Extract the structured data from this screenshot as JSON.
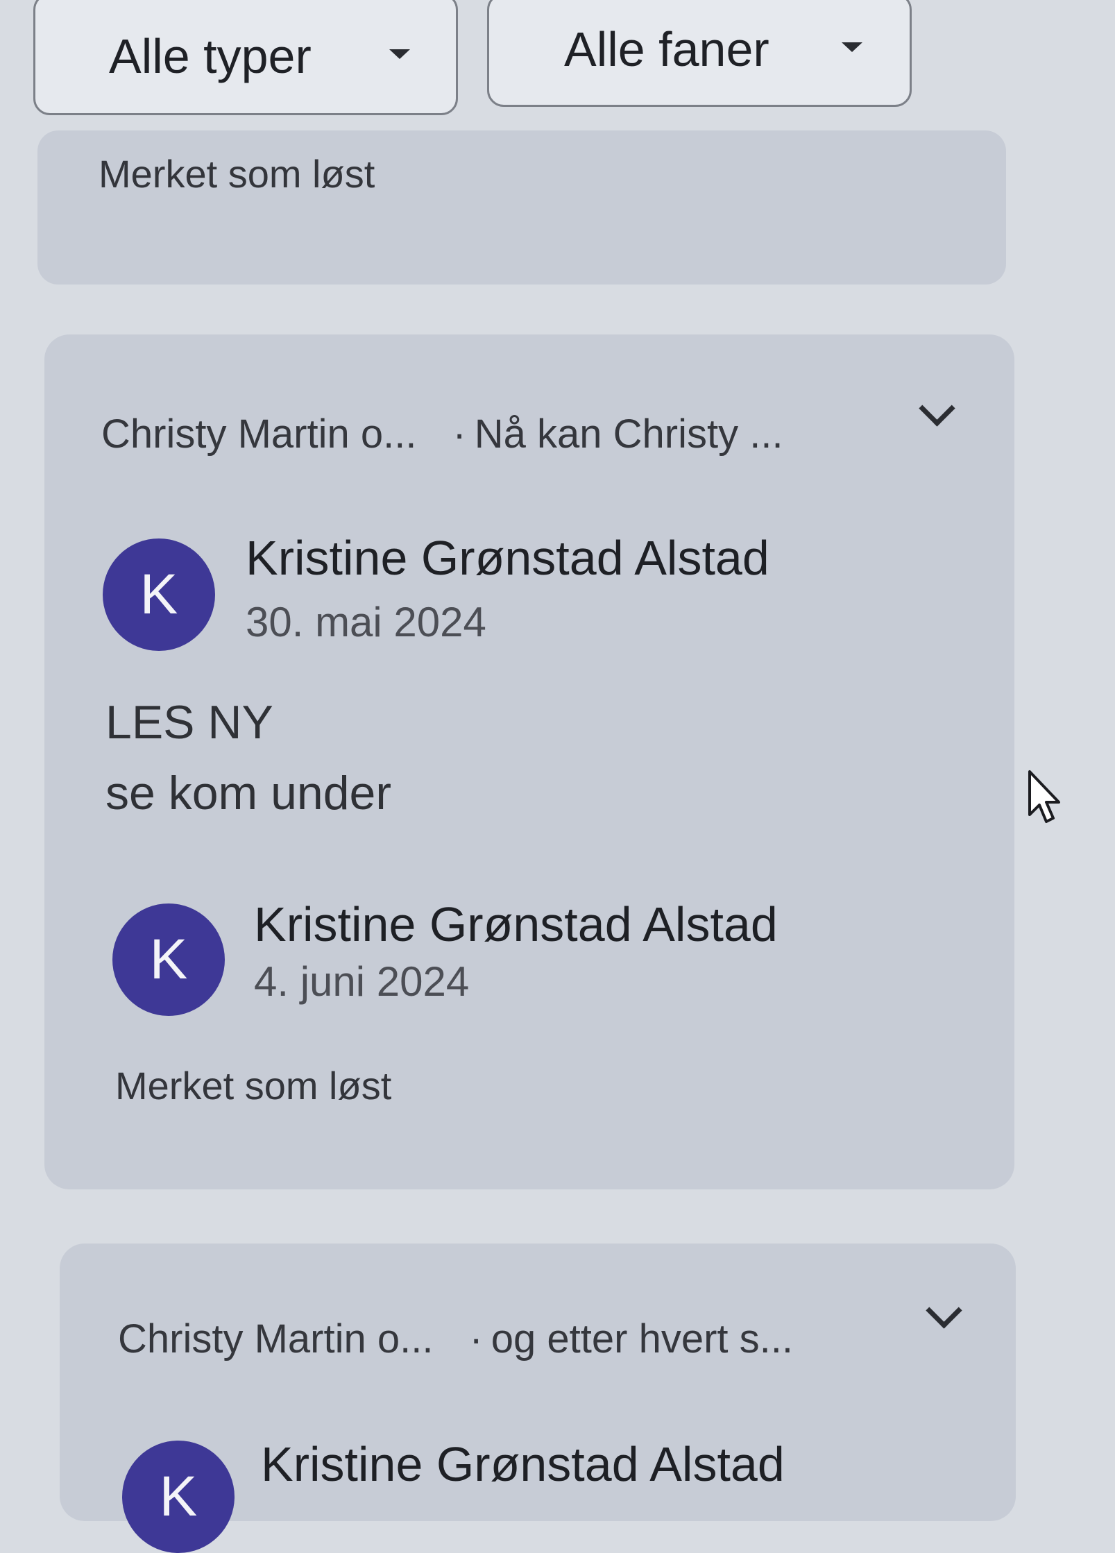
{
  "filters": {
    "types": {
      "label": "Alle typer",
      "icon": "caret-down-icon"
    },
    "tabs": {
      "label": "Alle faner",
      "icon": "caret-down-icon"
    }
  },
  "previous_card": {
    "status": "Merket som løst"
  },
  "threads": [
    {
      "participants": "Christy Martin o...",
      "separator": "·",
      "snippet": "Nå kan Christy ...",
      "expand_icon": "chevron-down-icon",
      "comments": [
        {
          "avatar_initial": "K",
          "author": "Kristine Grønstad Alstad",
          "date": "30. mai 2024",
          "body": [
            "LES NY",
            "se kom under"
          ]
        },
        {
          "avatar_initial": "K",
          "author": "Kristine Grønstad Alstad",
          "date": "4. juni 2024",
          "status": "Merket som løst"
        }
      ]
    },
    {
      "participants": "Christy Martin o...",
      "separator": "·",
      "snippet": "og etter hvert s...",
      "expand_icon": "chevron-down-icon",
      "comments": [
        {
          "avatar_initial": "K",
          "author": "Kristine Grønstad Alstad"
        }
      ]
    }
  ],
  "cursor": {
    "icon": "mouse-pointer-icon"
  },
  "colors": {
    "background": "#d8dce2",
    "card": "#c7ccd6",
    "avatar": "#3e3896",
    "text": "#2b2d33"
  }
}
